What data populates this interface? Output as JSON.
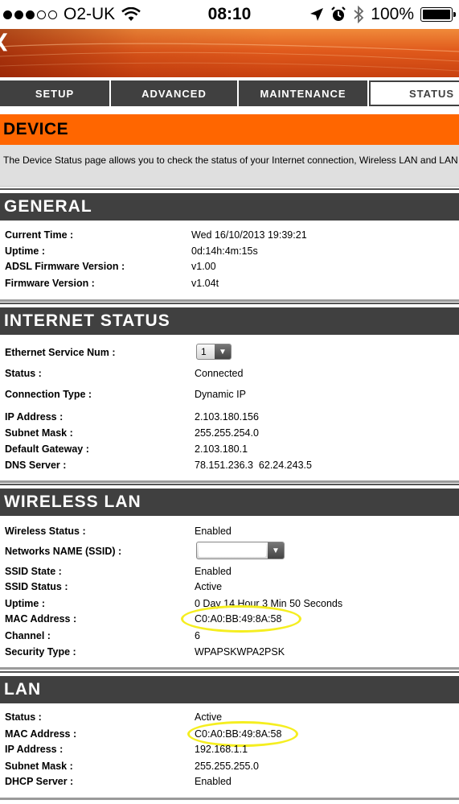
{
  "status_bar": {
    "carrier": "O2-UK",
    "time": "08:10",
    "battery": "100%"
  },
  "tabs": [
    {
      "label": "SETUP"
    },
    {
      "label": "ADVANCED"
    },
    {
      "label": "MAINTENANCE"
    },
    {
      "label": "STATUS"
    }
  ],
  "device": {
    "title": "DEVICE",
    "description": "The Device Status page allows you to check the status of your Internet connection, Wireless LAN and LAN"
  },
  "general": {
    "title": "GENERAL",
    "rows": [
      {
        "label": "Current Time :",
        "value": "Wed 16/10/2013 19:39:21"
      },
      {
        "label": "Uptime :",
        "value": "0d:14h:4m:15s"
      },
      {
        "label": "ADSL Firmware Version :",
        "value": "v1.00"
      },
      {
        "label": "Firmware Version :",
        "value": "v1.04t"
      }
    ]
  },
  "internet": {
    "title": "INTERNET STATUS",
    "service_label": "Ethernet Service Num :",
    "service_value": "1",
    "rows": [
      {
        "label": "Status :",
        "value": "Connected"
      },
      {
        "label": "Connection Type :",
        "value": "Dynamic IP"
      },
      {
        "label": "IP Address :",
        "value": "2.103.180.156"
      },
      {
        "label": "Subnet Mask :",
        "value": "255.255.254.0"
      },
      {
        "label": "Default Gateway :",
        "value": "2.103.180.1"
      },
      {
        "label": "DNS Server :",
        "value": "78.151.236.3  62.24.243.5"
      }
    ]
  },
  "wireless": {
    "title": "WIRELESS LAN",
    "rows_top": [
      {
        "label": "Wireless Status :",
        "value": "Enabled"
      }
    ],
    "ssid_label": "Networks NAME (SSID) :",
    "ssid_value": "",
    "rows": [
      {
        "label": "SSID State :",
        "value": "Enabled"
      },
      {
        "label": "SSID Status :",
        "value": "Active"
      },
      {
        "label": "Uptime :",
        "value": "0 Day 14 Hour 3 Min 50 Seconds"
      },
      {
        "label": "MAC Address :",
        "value": "C0:A0:BB:49:8A:58"
      },
      {
        "label": "Channel :",
        "value": "6"
      },
      {
        "label": "Security Type :",
        "value": "WPAPSKWPA2PSK"
      }
    ]
  },
  "lan": {
    "title": "LAN",
    "rows": [
      {
        "label": "Status :",
        "value": "Active"
      },
      {
        "label": "MAC Address :",
        "value": "C0:A0:BB:49:8A:58"
      },
      {
        "label": "IP Address :",
        "value": "192.168.1.1"
      },
      {
        "label": "Subnet Mask :",
        "value": "255.255.255.0"
      },
      {
        "label": "DHCP Server :",
        "value": "Enabled"
      }
    ]
  },
  "colors": {
    "accent": "#ff6600",
    "section_header": "#404040",
    "highlight": "#f5ee20"
  }
}
